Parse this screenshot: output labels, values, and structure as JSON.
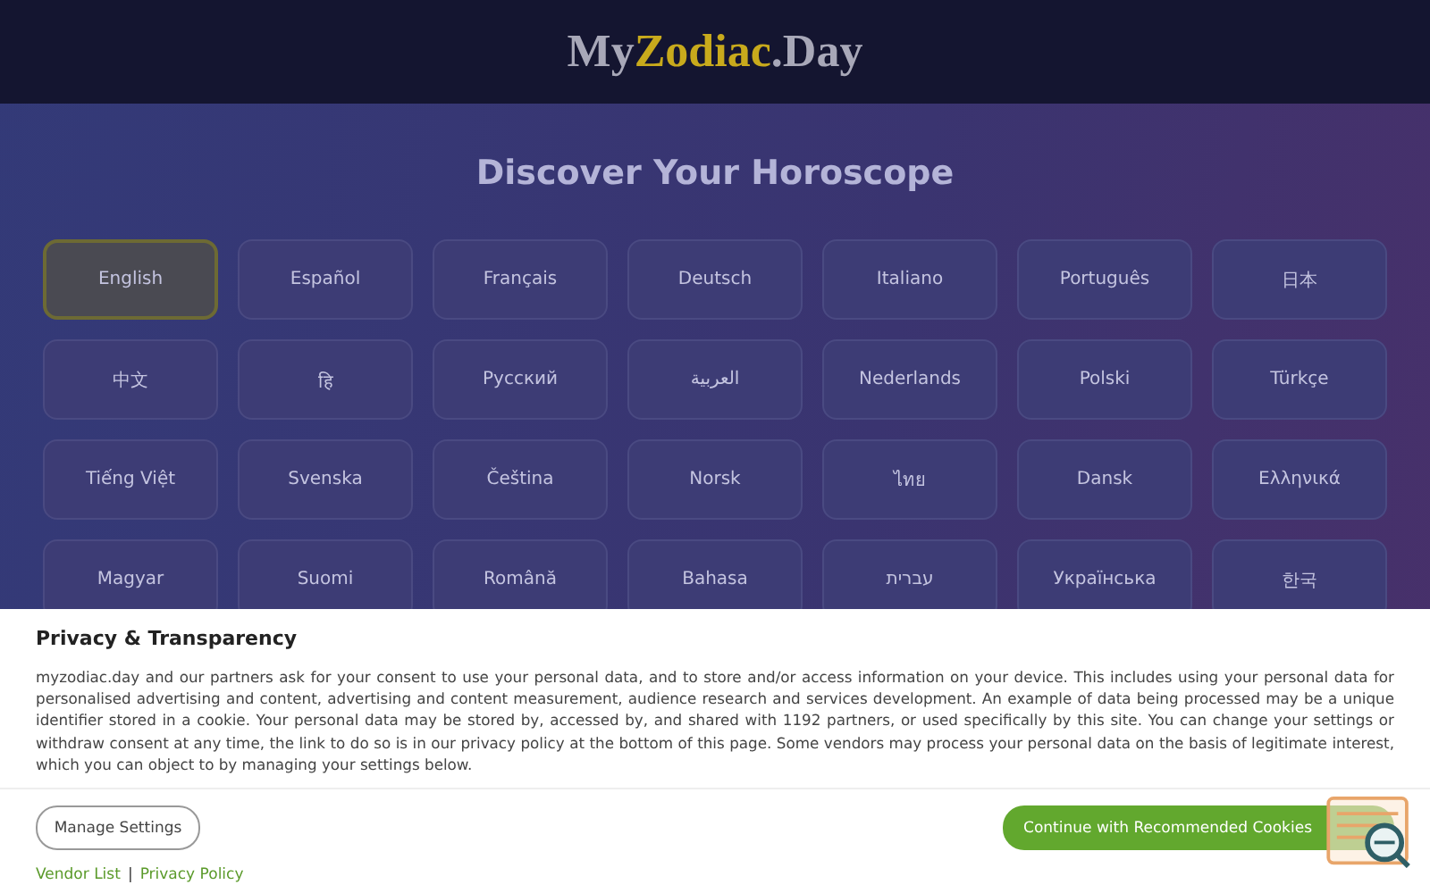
{
  "header": {
    "logo_parts": [
      {
        "text": "My",
        "kind": "plain"
      },
      {
        "text": "Zodiac",
        "kind": "accent"
      },
      {
        "text": ".Day",
        "kind": "plain"
      }
    ]
  },
  "heading": "Discover Your Horoscope",
  "languages": [
    {
      "label": "English",
      "selected": true
    },
    {
      "label": "Español",
      "selected": false
    },
    {
      "label": "Français",
      "selected": false
    },
    {
      "label": "Deutsch",
      "selected": false
    },
    {
      "label": "Italiano",
      "selected": false
    },
    {
      "label": "Português",
      "selected": false
    },
    {
      "label": "日本",
      "selected": false
    },
    {
      "label": "中文",
      "selected": false
    },
    {
      "label": "हि",
      "selected": false
    },
    {
      "label": "Русский",
      "selected": false
    },
    {
      "label": "العربية",
      "selected": false
    },
    {
      "label": "Nederlands",
      "selected": false
    },
    {
      "label": "Polski",
      "selected": false
    },
    {
      "label": "Türkçe",
      "selected": false
    },
    {
      "label": "Tiếng Việt",
      "selected": false
    },
    {
      "label": "Svenska",
      "selected": false
    },
    {
      "label": "Čeština",
      "selected": false
    },
    {
      "label": "Norsk",
      "selected": false
    },
    {
      "label": "ไทย",
      "selected": false
    },
    {
      "label": "Dansk",
      "selected": false
    },
    {
      "label": "Ελληνικά",
      "selected": false
    },
    {
      "label": "Magyar",
      "selected": false
    },
    {
      "label": "Suomi",
      "selected": false
    },
    {
      "label": "Română",
      "selected": false
    },
    {
      "label": "Bahasa",
      "selected": false
    },
    {
      "label": "עברית",
      "selected": false
    },
    {
      "label": "Українська",
      "selected": false
    },
    {
      "label": "한국",
      "selected": false
    }
  ],
  "consent": {
    "title": "Privacy & Transparency",
    "body": "myzodiac.day and our partners ask for your consent to use your personal data, and to store and/or access information on your device. This includes using your personal data for personalised advertising and content, advertising and content measurement, audience research and services development. An example of data being processed may be a unique identifier stored in a cookie. Your personal data may be stored by, accessed by, and shared with 1192 partners, or used specifically by this site. You can change your settings or withdraw consent at any time, the link to do so is in our privacy policy at the bottom of this page. Some vendors may process your personal data on the basis of legitimate interest, which you can object to by managing your settings below.",
    "manage_button": "Manage Settings",
    "accept_button": "Continue with Recommended Cookies",
    "links": [
      "Vendor List",
      "Privacy Policy"
    ],
    "separator": "|"
  }
}
